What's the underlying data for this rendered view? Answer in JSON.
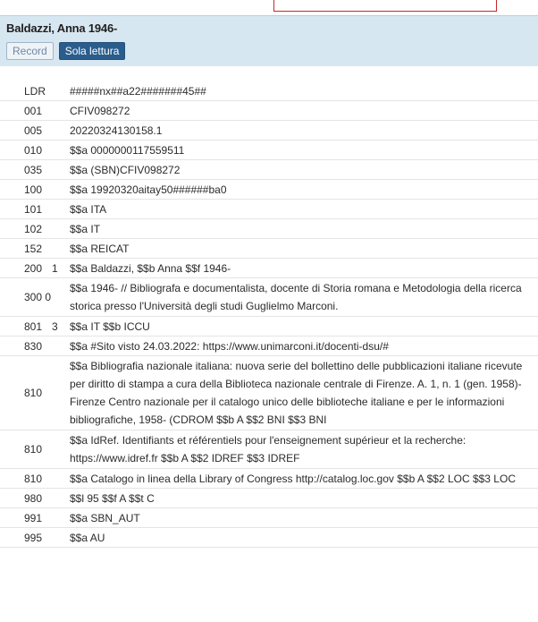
{
  "header": {
    "title": "Baldazzi, Anna 1946-",
    "buttons": {
      "record": "Record",
      "readonly": "Sola lettura"
    }
  },
  "rows": [
    {
      "tag": "LDR",
      "ind": "",
      "value": "#####nx##a22#######45##"
    },
    {
      "tag": "001",
      "ind": "",
      "value": "CFIV098272"
    },
    {
      "tag": "005",
      "ind": "",
      "value": "20220324130158.1"
    },
    {
      "tag": "010",
      "ind": "",
      "value": "$$a 0000000117559511"
    },
    {
      "tag": "035",
      "ind": "",
      "value": "$$a (SBN)CFIV098272"
    },
    {
      "tag": "100",
      "ind": "",
      "value": "$$a 19920320aitay50######ba0"
    },
    {
      "tag": "101",
      "ind": "",
      "value": "$$a ITA"
    },
    {
      "tag": "102",
      "ind": "",
      "value": "$$a IT"
    },
    {
      "tag": "152",
      "ind": "",
      "value": "$$a REICAT"
    },
    {
      "tag": "200",
      "ind": "1",
      "value": "$$a Baldazzi, $$b Anna $$f 1946-"
    },
    {
      "tag": "300 0",
      "ind": "",
      "value": "$$a 1946- // Bibliografa e documentalista, docente di Storia romana e Metodologia della ricerca storica presso l'Università degli studi Guglielmo Marconi."
    },
    {
      "tag": "801",
      "ind": "3",
      "value": "$$a IT $$b ICCU"
    },
    {
      "tag": "830",
      "ind": "",
      "value": "$$a #Sito visto 24.03.2022: https://www.unimarconi.it/docenti-dsu/#"
    },
    {
      "tag": "810",
      "ind": "",
      "value": "$$a Bibliografia nazionale italiana: nuova serie del bollettino delle pubblicazioni italiane ricevute per diritto di stampa a cura della Biblioteca nazionale centrale di Firenze. A. 1, n. 1 (gen. 1958)- Firenze Centro nazionale per il catalogo unico delle biblioteche italiane e per le informazioni bibliografiche, 1958- (CDROM $$b A $$2 BNI $$3 BNI"
    },
    {
      "tag": "810",
      "ind": "",
      "value": "$$a IdRef. Identifiants et référentiels pour l'enseignement supérieur et la recherche: https://www.idref.fr $$b A $$2 IDREF $$3 IDREF"
    },
    {
      "tag": "810",
      "ind": "",
      "value": "$$a Catalogo in linea della Library of Congress http://catalog.loc.gov $$b A $$2 LOC $$3 LOC"
    },
    {
      "tag": "980",
      "ind": "",
      "value": "$$l 95 $$f A $$t C"
    },
    {
      "tag": "991",
      "ind": "",
      "value": "$$a SBN_AUT"
    },
    {
      "tag": "995",
      "ind": "",
      "value": "$$a AU"
    }
  ]
}
